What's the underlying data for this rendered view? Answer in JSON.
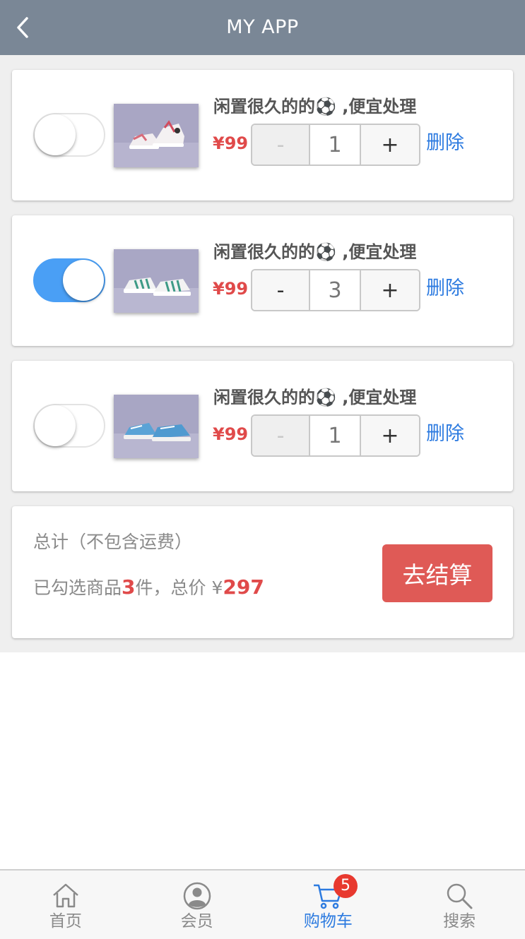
{
  "header": {
    "title": "MY APP",
    "back_icon": "chevron-left-icon"
  },
  "cart": {
    "items": [
      {
        "name": "闲置很久的的⚽ ,便宜处理",
        "price": "¥99",
        "quantity": "1",
        "minus_label": "-",
        "plus_label": "+",
        "delete_label": "删除",
        "selected": false,
        "minus_disabled": true
      },
      {
        "name": "闲置很久的的⚽ ,便宜处理",
        "price": "¥99",
        "quantity": "3",
        "minus_label": "-",
        "plus_label": "+",
        "delete_label": "删除",
        "selected": true,
        "minus_disabled": false
      },
      {
        "name": "闲置很久的的⚽ ,便宜处理",
        "price": "¥99",
        "quantity": "1",
        "minus_label": "-",
        "plus_label": "+",
        "delete_label": "删除",
        "selected": false,
        "minus_disabled": true
      }
    ]
  },
  "summary": {
    "label": "总计（不包含运费）",
    "selected_prefix": "已勾选商品",
    "selected_count": "3",
    "selected_suffix": "件，总价 ¥",
    "total": "297",
    "checkout_label": "去结算"
  },
  "tabbar": {
    "tabs": [
      {
        "label": "首页",
        "icon": "home-icon"
      },
      {
        "label": "会员",
        "icon": "user-icon"
      },
      {
        "label": "购物车",
        "icon": "cart-icon",
        "badge": "5",
        "active": true
      },
      {
        "label": "搜索",
        "icon": "search-icon"
      }
    ]
  },
  "colors": {
    "header_bg": "#7a8796",
    "price_red": "#e04a4a",
    "link_blue": "#2d7be0",
    "toggle_on": "#4a9ff5",
    "checkout_bg": "#df5a56",
    "badge_red": "#e8392f"
  }
}
